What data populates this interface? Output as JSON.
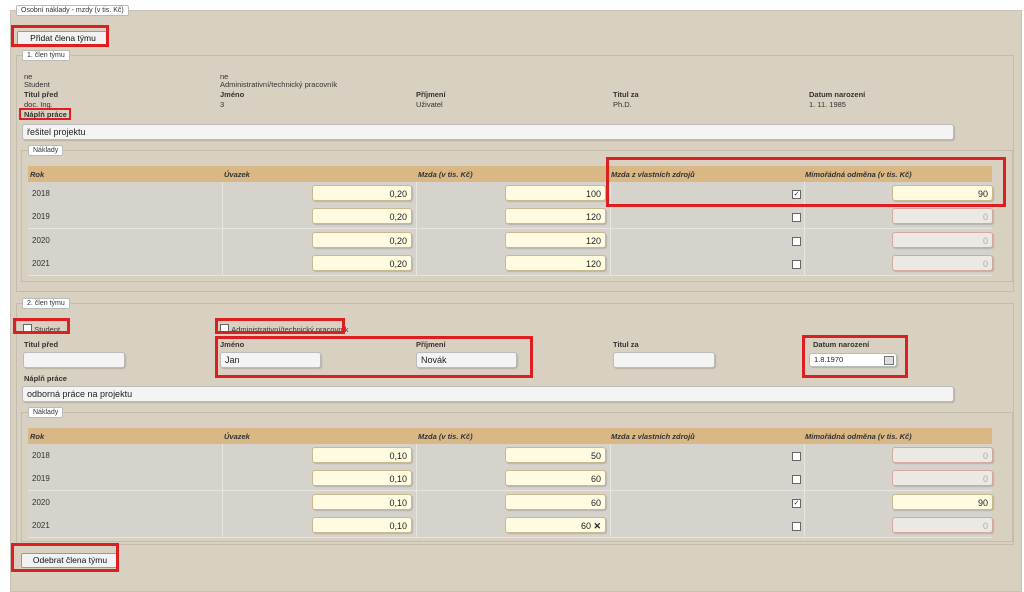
{
  "section_title": "Osobní náklady - mzdy (v tis. Kč)",
  "add_button": "Přidat člena týmu",
  "remove_button": "Odebrat člena týmu",
  "member1": {
    "legend": "1. člen týmu",
    "student_value": "ne",
    "student_label": "Student",
    "admin_value": "ne",
    "admin_label": "Administrativní/technický pracovník",
    "titul_pred_label": "Titul před",
    "titul_pred_value": "doc. Ing.",
    "jmeno_label": "Jméno",
    "jmeno_value": "3",
    "prijmeni_label": "Příjmení",
    "prijmeni_value": "Uživatel",
    "titul_za_label": "Titul za",
    "titul_za_value": "Ph.D.",
    "datum_label": "Datum narození",
    "datum_value": "1. 11. 1985",
    "napln_label": "Náplň práce",
    "napln_value": "řešitel projektu",
    "naklady_legend": "Náklady",
    "rows": [
      {
        "rok": "2018",
        "uvazek": "0,20",
        "mzda": "100",
        "vlastni": true,
        "odmena": "90"
      },
      {
        "rok": "2019",
        "uvazek": "0,20",
        "mzda": "120",
        "vlastni": false,
        "odmena": "0"
      },
      {
        "rok": "2020",
        "uvazek": "0,20",
        "mzda": "120",
        "vlastni": false,
        "odmena": "0"
      },
      {
        "rok": "2021",
        "uvazek": "0,20",
        "mzda": "120",
        "vlastni": false,
        "odmena": "0"
      }
    ]
  },
  "member2": {
    "legend": "2. člen týmu",
    "student_label": "Student",
    "admin_label": "Administrativní/technický pracovník",
    "titul_pred_label": "Titul před",
    "titul_pred_value": "",
    "jmeno_label": "Jméno",
    "jmeno_value": "Jan",
    "prijmeni_label": "Příjmení",
    "prijmeni_value": "Novák",
    "titul_za_label": "Titul za",
    "titul_za_value": "",
    "datum_label": "Datum narození",
    "datum_value": "1.8.1970",
    "napln_label": "Náplň práce",
    "napln_value": "odborná práce na projektu",
    "naklady_legend": "Náklady",
    "rows": [
      {
        "rok": "2018",
        "uvazek": "0,10",
        "mzda": "50",
        "vlastni": false,
        "odmena": "0"
      },
      {
        "rok": "2019",
        "uvazek": "0,10",
        "mzda": "60",
        "vlastni": false,
        "odmena": "0"
      },
      {
        "rok": "2020",
        "uvazek": "0,10",
        "mzda": "60",
        "vlastni": true,
        "odmena": "90"
      },
      {
        "rok": "2021",
        "uvazek": "0,10",
        "mzda": "60",
        "vlastni": false,
        "odmena": "0"
      }
    ]
  },
  "columns": {
    "rok": "Rok",
    "uvazek": "Úvazek",
    "mzda": "Mzda (v tis. Kč)",
    "vlastni": "Mzda z vlastních zdrojů",
    "odmena": "Mimořádná odměna (v tis. Kč)"
  },
  "icons": {
    "checkmark": "✓",
    "clear": "✕",
    "calendar": "calendar-icon"
  },
  "colors": {
    "highlight": "#dd1f22",
    "table_header": "#d9b886",
    "panel": "#d8d0c0"
  }
}
